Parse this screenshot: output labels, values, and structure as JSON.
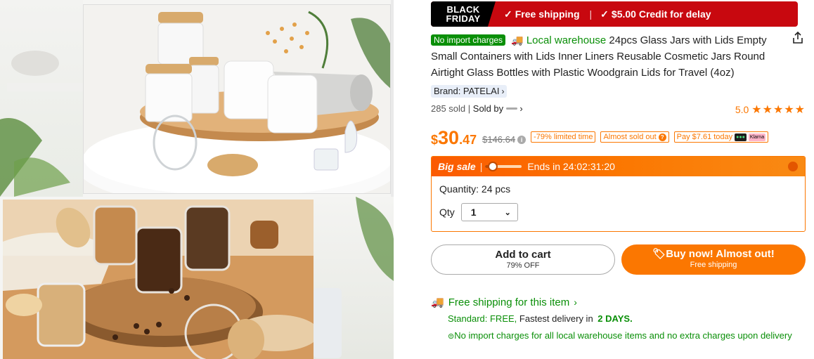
{
  "promo": {
    "black": "BLACK",
    "friday": "FRIDAY",
    "free_shipping": "Free shipping",
    "credit": "$5.00 Credit for delay",
    "accent": "#c8080f"
  },
  "product": {
    "no_import_badge": "No import charges",
    "local_warehouse": "Local warehouse",
    "title": "24pcs Glass Jars with Lids Empty Small Containers with Lids Inner Liners Reusable Cosmetic Jars Round Airtight Glass Bottles with Plastic Woodgrain Lids for Travel (4oz)",
    "brand": "Brand: PATELAI",
    "sold": "285 sold",
    "sold_by": "Sold by",
    "rating": "5.0",
    "rating_value": 5
  },
  "price": {
    "currency": "$",
    "dollars": "30",
    "cents": ".47",
    "original": "$146.64",
    "chip_limited": "-79% limited time",
    "chip_almost": "Almost sold out",
    "chip_pay": "Pay $7.61 today",
    "accent": "#fb7701"
  },
  "sale": {
    "label": "Big sale",
    "ends": "Ends in 24:02:31:20",
    "progress_fraction": 0.2,
    "quantity_text": "Quantity: 24 pcs",
    "qty_label": "Qty",
    "qty_value": "1"
  },
  "actions": {
    "add_to_cart": "Add to cart",
    "add_to_cart_sub": "79% OFF",
    "buy_now": "Buy now! Almost out!",
    "buy_now_sub": "Free shipping"
  },
  "shipping": {
    "headline": "Free shipping for this item",
    "standard": "Standard: FREE,",
    "fastest": "Fastest delivery in",
    "days": "2 DAYS.",
    "note": "No import charges for all local warehouse items and no extra charges upon delivery"
  }
}
